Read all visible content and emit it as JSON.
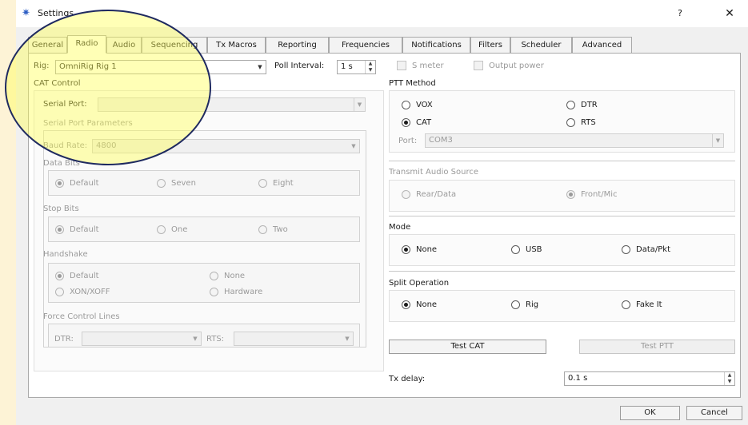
{
  "window": {
    "title": "Settings",
    "help_label": "?",
    "close_label": "✕"
  },
  "tabs": [
    "General",
    "Radio",
    "Audio",
    "Sequencing",
    "Tx Macros",
    "Reporting",
    "Frequencies",
    "Notifications",
    "Filters",
    "Scheduler",
    "Advanced"
  ],
  "active_tab": "Radio",
  "rig": {
    "label": "Rig:",
    "value": "OmniRig Rig 1",
    "poll_label": "Poll Interval:",
    "poll_value": "1 s",
    "s_meter_label": "S meter",
    "output_power_label": "Output power"
  },
  "cat": {
    "heading": "CAT Control",
    "serial_port_label": "Serial Port:",
    "serial_port_value": "",
    "serial_params_heading": "Serial Port Parameters",
    "baud_label": "Baud Rate:",
    "baud_value": "4800",
    "data_bits": {
      "heading": "Data Bits",
      "options": [
        "Default",
        "Seven",
        "Eight"
      ]
    },
    "stop_bits": {
      "heading": "Stop Bits",
      "options": [
        "Default",
        "One",
        "Two"
      ]
    },
    "handshake": {
      "heading": "Handshake",
      "options": [
        "Default",
        "None",
        "XON/XOFF",
        "Hardware"
      ]
    },
    "force_lines": {
      "heading": "Force Control Lines",
      "dtr_label": "DTR:",
      "rts_label": "RTS:"
    }
  },
  "ptt": {
    "heading": "PTT Method",
    "options": [
      "VOX",
      "DTR",
      "CAT",
      "RTS"
    ],
    "port_label": "Port:",
    "port_value": "COM3"
  },
  "audio_source": {
    "heading": "Transmit Audio Source",
    "options": [
      "Rear/Data",
      "Front/Mic"
    ]
  },
  "mode": {
    "heading": "Mode",
    "options": [
      "None",
      "USB",
      "Data/Pkt"
    ]
  },
  "split": {
    "heading": "Split Operation",
    "options": [
      "None",
      "Rig",
      "Fake It"
    ]
  },
  "buttons": {
    "test_cat": "Test CAT",
    "test_ptt": "Test PTT",
    "ok": "OK",
    "cancel": "Cancel"
  },
  "tx_delay": {
    "label": "Tx delay:",
    "value": "0.1 s"
  },
  "colors": {
    "background": "#fdf3d6",
    "highlight": "#ffff50",
    "highlight_border": "#1f2a60"
  }
}
